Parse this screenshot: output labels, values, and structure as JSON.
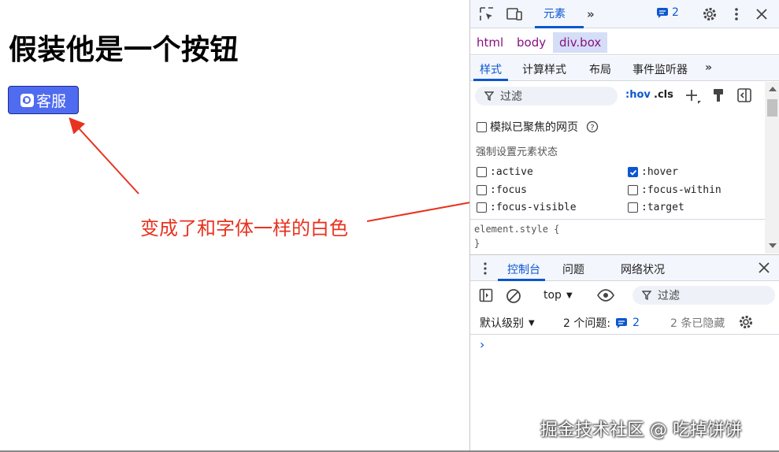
{
  "page": {
    "title": "假装他是一个按钮",
    "button_label": "客服",
    "annotation": "变成了和字体一样的白色",
    "accent": "#4f6bf0",
    "annotation_color": "#e8321f"
  },
  "devtools": {
    "top_tab": "元素",
    "issues_count": "2",
    "breadcrumbs": [
      "html",
      "body",
      "div.box"
    ],
    "subtabs": [
      "样式",
      "计算样式",
      "布局",
      "事件监听器"
    ],
    "filter_placeholder": "过滤",
    "hov": ":hov",
    "cls": ".cls",
    "emulate_focus": "模拟已聚焦的网页",
    "force_state_label": "强制设置元素状态",
    "states": [
      {
        "label": ":active",
        "checked": false
      },
      {
        "label": ":hover",
        "checked": true
      },
      {
        "label": ":focus",
        "checked": false
      },
      {
        "label": ":focus-within",
        "checked": false
      },
      {
        "label": ":focus-visible",
        "checked": false
      },
      {
        "label": ":target",
        "checked": false
      }
    ],
    "element_style_open": "element.style {",
    "element_style_close": "}",
    "console_tabs": [
      "控制台",
      "问题",
      "网络状况"
    ],
    "context": "top",
    "console_filter": "过滤",
    "default_levels": "默认级别",
    "issues_label": "2 个问题:",
    "issues_num": "2",
    "hidden_label": "2 条已隐藏",
    "accent": "#0b57d0"
  },
  "watermark": "掘金技术社区 @ 吃掉饼饼"
}
